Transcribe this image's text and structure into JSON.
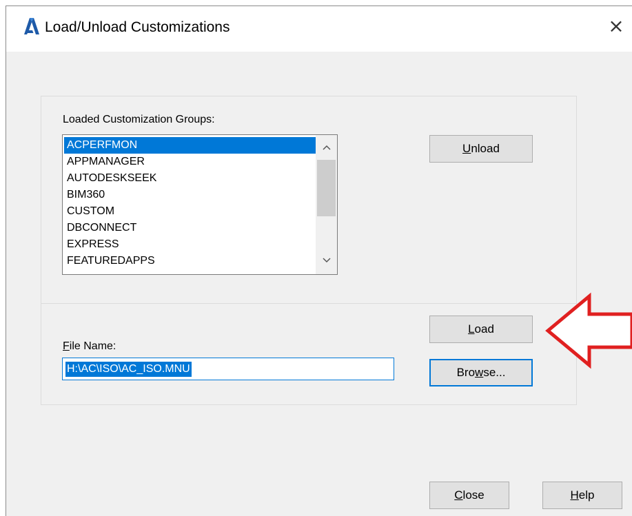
{
  "window": {
    "title": "Load/Unload Customizations",
    "app_icon": "autocad-a-icon",
    "close_glyph": "×"
  },
  "loaded_groups": {
    "label": "Loaded Customization Groups:",
    "items": [
      {
        "label": "ACPERFMON",
        "selected": true
      },
      {
        "label": "APPMANAGER",
        "selected": false
      },
      {
        "label": "AUTODESKSEEK",
        "selected": false
      },
      {
        "label": "BIM360",
        "selected": false
      },
      {
        "label": "CUSTOM",
        "selected": false
      },
      {
        "label": "DBCONNECT",
        "selected": false
      },
      {
        "label": "EXPRESS",
        "selected": false
      },
      {
        "label": "FEATUREDAPPS",
        "selected": false
      }
    ],
    "scroll_up_glyph": "^",
    "scroll_down_glyph": "v"
  },
  "buttons": {
    "unload": {
      "pre": "",
      "ul": "U",
      "post": "nload"
    },
    "load": {
      "pre": "",
      "ul": "L",
      "post": "oad"
    },
    "browse": {
      "pre": "Bro",
      "ul": "w",
      "post": "se..."
    },
    "close": {
      "pre": "",
      "ul": "C",
      "post": "lose"
    },
    "help": {
      "pre": "",
      "ul": "H",
      "post": "elp"
    }
  },
  "file_name": {
    "label_ul": "F",
    "label_rest": "ile Name:",
    "value": "H:\\AC\\ISO\\AC_ISO.MNU"
  },
  "annotation": {
    "arrow_icon": "red-arrow-left-icon",
    "arrow_color": "#e02020"
  },
  "colors": {
    "selection": "#0078d7",
    "dialog_bg": "#f0f0f0",
    "button_bg": "#e1e1e1"
  }
}
